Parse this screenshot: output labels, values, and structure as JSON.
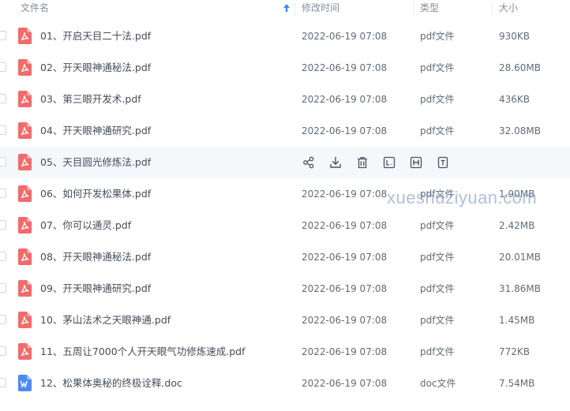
{
  "header": {
    "name_label": "文件名",
    "modified_label": "修改时间",
    "type_label": "类型",
    "size_label": "大小"
  },
  "files": [
    {
      "name": "01、开启天目二十法.pdf",
      "modified": "2022-06-19 07:08",
      "type": "pdf文件",
      "size": "930KB",
      "icon": "pdf-file-icon"
    },
    {
      "name": "02、开天眼神通秘法.pdf",
      "modified": "2022-06-19 07:08",
      "type": "pdf文件",
      "size": "28.60MB",
      "icon": "pdf-file-icon"
    },
    {
      "name": "03、第三眼开发术.pdf",
      "modified": "2022-06-19 07:08",
      "type": "pdf文件",
      "size": "436KB",
      "icon": "pdf-file-icon"
    },
    {
      "name": "04、开天眼神通研究.pdf",
      "modified": "2022-06-19 07:08",
      "type": "pdf文件",
      "size": "32.08MB",
      "icon": "pdf-file-icon"
    },
    {
      "name": "05、天目圆光修炼法.pdf",
      "modified": "",
      "type": "",
      "size": "",
      "icon": "pdf-file-icon",
      "hovered": true
    },
    {
      "name": "06、如何开发松果体.pdf",
      "modified": "2022-06-19 07:08",
      "type": "pdf文件",
      "size": "1.90MB",
      "icon": "pdf-file-icon"
    },
    {
      "name": "07、你可以通灵.pdf",
      "modified": "2022-06-19 07:08",
      "type": "pdf文件",
      "size": "2.42MB",
      "icon": "pdf-file-icon"
    },
    {
      "name": "08、开天眼神通秘法.pdf",
      "modified": "2022-06-19 07:08",
      "type": "pdf文件",
      "size": "20.01MB",
      "icon": "pdf-file-icon"
    },
    {
      "name": "09、开天眼神通研究.pdf",
      "modified": "2022-06-19 07:08",
      "type": "pdf文件",
      "size": "31.86MB",
      "icon": "pdf-file-icon"
    },
    {
      "name": "10、茅山法术之天眼神通.pdf",
      "modified": "2022-06-19 07:08",
      "type": "pdf文件",
      "size": "1.45MB",
      "icon": "pdf-file-icon"
    },
    {
      "name": "11、五周让7000个人开天眼气功修炼速成.pdf",
      "modified": "2022-06-19 07:08",
      "type": "pdf文件",
      "size": "772KB",
      "icon": "pdf-file-icon"
    },
    {
      "name": "12、松果体奥秘的终极诠释.doc",
      "modified": "2022-06-19 07:08",
      "type": "doc文件",
      "size": "7.54MB",
      "icon": "word-file-icon"
    }
  ],
  "hover_actions": [
    "share-icon",
    "download-icon",
    "delete-icon",
    "rename-icon",
    "copy-icon",
    "more-icon"
  ],
  "watermark": "xueshuziyuan.com",
  "colors": {
    "pdf_icon": "#f26b6b",
    "word_icon": "#4a8af4",
    "hover_row": "#f5f7fb",
    "sort_arrow": "#3b8cf0"
  }
}
